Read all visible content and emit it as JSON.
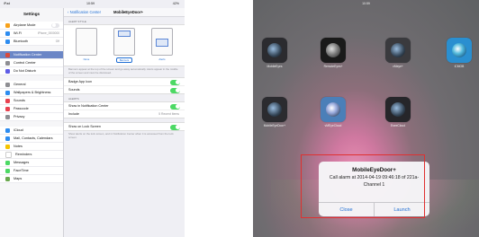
{
  "left": {
    "status": {
      "carrier": "iPad",
      "time": "10:59",
      "battery": "42%"
    },
    "sidebar": {
      "title": "Settings",
      "items": [
        {
          "label": "Airplane Mode",
          "icon": "airplane-icon",
          "color": "#f7a11a",
          "value": ""
        },
        {
          "label": "Wi-Fi",
          "icon": "wifi-icon",
          "color": "#2d8cf0",
          "value": "iPhone_0000000"
        },
        {
          "label": "Bluetooth",
          "icon": "bluetooth-icon",
          "color": "#2d8cf0",
          "value": "Off"
        },
        {
          "label": "Notification Center",
          "icon": "notification-icon",
          "color": "#d84a3c",
          "value": ""
        },
        {
          "label": "Control Center",
          "icon": "control-center-icon",
          "color": "#8e8e93",
          "value": ""
        },
        {
          "label": "Do Not Disturb",
          "icon": "moon-icon",
          "color": "#5e5ce6",
          "value": ""
        },
        {
          "label": "General",
          "icon": "gear-icon",
          "color": "#8e8e93",
          "value": ""
        },
        {
          "label": "Wallpapers & Brightness",
          "icon": "wallpaper-icon",
          "color": "#2d8cf0",
          "value": ""
        },
        {
          "label": "Sounds",
          "icon": "sound-icon",
          "color": "#e8414f",
          "value": ""
        },
        {
          "label": "Passcode",
          "icon": "lock-icon",
          "color": "#e8414f",
          "value": ""
        },
        {
          "label": "Privacy",
          "icon": "hand-icon",
          "color": "#8e8e93",
          "value": ""
        },
        {
          "label": "iCloud",
          "icon": "cloud-icon",
          "color": "#2d8cf0",
          "value": ""
        },
        {
          "label": "Mail, Contacts, Calendars",
          "icon": "mail-icon",
          "color": "#2d8cf0",
          "value": ""
        },
        {
          "label": "Notes",
          "icon": "notes-icon",
          "color": "#f5c400",
          "value": ""
        },
        {
          "label": "Reminders",
          "icon": "reminders-icon",
          "color": "#ffffff",
          "value": ""
        },
        {
          "label": "Messages",
          "icon": "messages-icon",
          "color": "#4cd964",
          "value": ""
        },
        {
          "label": "FaceTime",
          "icon": "facetime-icon",
          "color": "#4cd964",
          "value": ""
        },
        {
          "label": "Maps",
          "icon": "maps-icon",
          "color": "#6aa84f",
          "value": ""
        }
      ]
    },
    "detail": {
      "back_label": "Notification Center",
      "title": "MobileEyeDoor+",
      "alert_style_header": "ALERT STYLE",
      "styles": [
        "None",
        "Banners",
        "Alerts"
      ],
      "style_note": "Banners appear at the top of the screen and go away automatically. Alerts appear in the middle of the screen and must be dismissed.",
      "rows_group1": [
        {
          "label": "Badge App Icon"
        },
        {
          "label": "Sounds"
        }
      ],
      "notif_header": "ALERTS",
      "rows_group2": [
        {
          "label": "Show in Notification Center",
          "value": ""
        },
        {
          "label": "Include",
          "value": "5 Recent Items"
        }
      ],
      "rows_group3": [
        {
          "label": "Show on Lock Screen"
        }
      ],
      "lock_note": "Show alerts on the lock screen, and in Notification Center when it is accessed from the lock screen."
    }
  },
  "right": {
    "status": {
      "time": "10:59"
    },
    "apps": [
      {
        "label": "MobileEyes"
      },
      {
        "label": "RemoteEyes+"
      },
      {
        "label": "vMeye+"
      },
      {
        "label": "iCMOB"
      },
      {
        "label": "MobileEyeDoor+"
      },
      {
        "label": "vMEyeCloud"
      },
      {
        "label": "EseeCloud"
      }
    ],
    "alert": {
      "title": "MobileEyeDoor+",
      "message": "Call alarm at 2014-04-19 09:46:18 of 221a-Channel 1",
      "close_label": "Close",
      "launch_label": "Launch"
    },
    "highlight_color": "#e03030"
  }
}
